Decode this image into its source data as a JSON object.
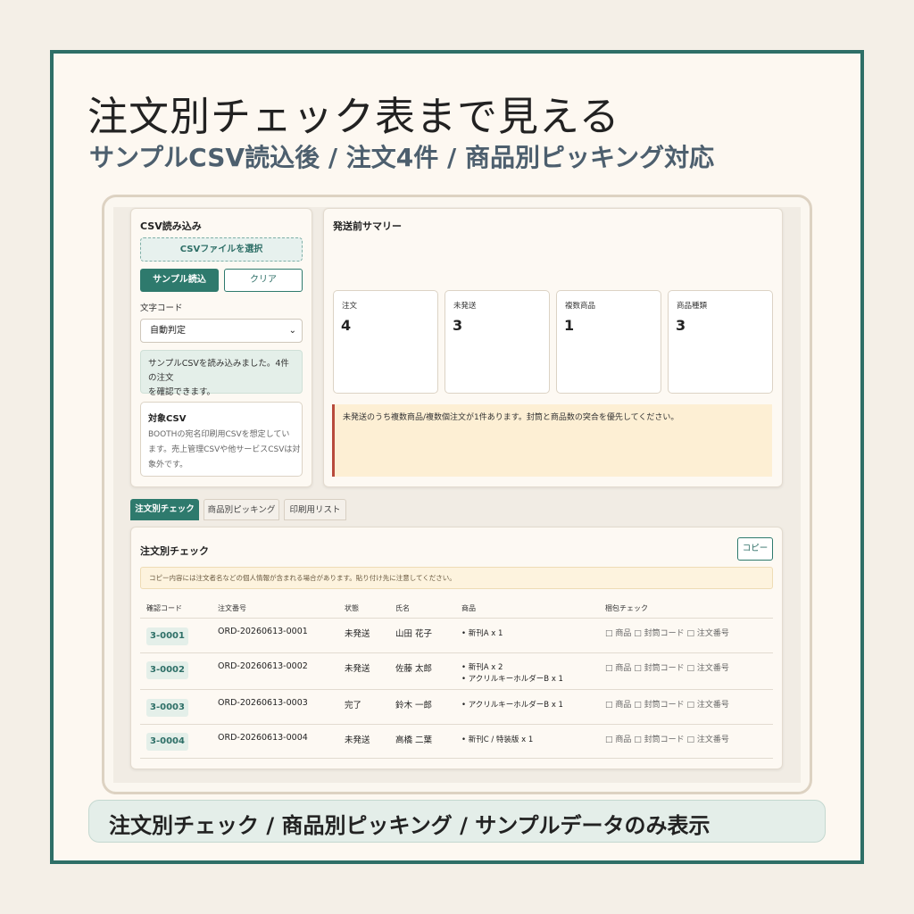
{
  "headline": "注文別チェック表まで見える",
  "subheadline": "サンプルCSV読込後 / 注文4件 / 商品別ピッキング対応",
  "csv_panel": {
    "title": "CSV読み込み",
    "file_button": "CSVファイルを選択",
    "sample_button": "サンプル読込",
    "clear_button": "クリア",
    "encoding_label": "文字コード",
    "encoding_value": "自動判定",
    "loaded_line1": "サンプルCSVを読み込みました。4件の注文",
    "loaded_line2": "を確認できます。",
    "target_title": "対象CSV",
    "target_line1": "BOOTHの宛名印刷用CSVを想定してい",
    "target_line2": "ます。売上管理CSVや他サービスCSVは対",
    "target_line3": "象外です。"
  },
  "summary": {
    "title": "発送前サマリー",
    "stats": [
      {
        "label": "注文",
        "value": "4"
      },
      {
        "label": "未発送",
        "value": "3"
      },
      {
        "label": "複数商品",
        "value": "1"
      },
      {
        "label": "商品種類",
        "value": "3"
      }
    ],
    "warning": "未発送のうち複数商品/複数個注文が1件あります。封筒と商品数の突合を優先してください。"
  },
  "tabs": [
    "注文別チェック",
    "商品別ピッキング",
    "印刷用リスト"
  ],
  "orders_panel": {
    "title": "注文別チェック",
    "copy_button": "コピー",
    "copy_notice": "コピー内容には注文者名などの個人情報が含まれる場合があります。貼り付け先に注意してください。",
    "columns": [
      "確認コード",
      "注文番号",
      "状態",
      "氏名",
      "商品",
      "梱包チェック"
    ],
    "checks": "□ 商品 □ 封筒コード □ 注文番号",
    "rows": [
      {
        "code": "3-0001",
        "order": "ORD-20260613-0001",
        "status": "未発送",
        "name": "山田 花子",
        "items": [
          "新刊A x 1"
        ]
      },
      {
        "code": "3-0002",
        "order": "ORD-20260613-0002",
        "status": "未発送",
        "name": "佐藤 太郎",
        "items": [
          "新刊A x 2",
          "アクリルキーホルダーB x 1"
        ]
      },
      {
        "code": "3-0003",
        "order": "ORD-20260613-0003",
        "status": "完了",
        "name": "鈴木 一郎",
        "items": [
          "アクリルキーホルダーB x 1"
        ]
      },
      {
        "code": "3-0004",
        "order": "ORD-20260613-0004",
        "status": "未発送",
        "name": "高橋 二葉",
        "items": [
          "新刊C / 特装版 x 1"
        ]
      }
    ]
  },
  "footer": "注文別チェック / 商品別ピッキング / サンプルデータのみ表示"
}
